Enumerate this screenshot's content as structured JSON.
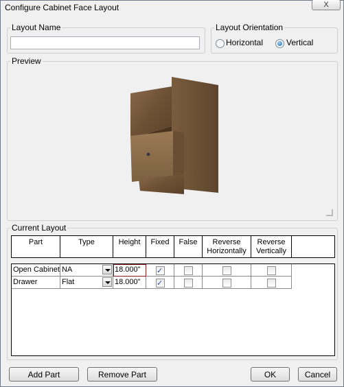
{
  "window": {
    "title": "Configure Cabinet Face Layout",
    "close_label": "X"
  },
  "layout_name": {
    "label": "Layout Name",
    "value": ""
  },
  "orientation": {
    "label": "Layout Orientation",
    "options": [
      {
        "label": "Horizontal",
        "selected": false
      },
      {
        "label": "Vertical",
        "selected": true
      }
    ]
  },
  "preview": {
    "label": "Preview"
  },
  "current_layout": {
    "label": "Current Layout",
    "columns": [
      "Part",
      "Type",
      "Height",
      "Fixed",
      "False",
      "Reverse Horizontally",
      "Reverse Vertically"
    ],
    "rows": [
      {
        "part": "Open Cabinet",
        "type": "NA",
        "height": "18.000\"",
        "fixed": true,
        "false": false,
        "rev_h": false,
        "rev_v": false
      },
      {
        "part": "Drawer",
        "type": "Flat",
        "height": "18.000\"",
        "fixed": true,
        "false": false,
        "rev_h": false,
        "rev_v": false
      }
    ]
  },
  "buttons": {
    "add_part": "Add Part",
    "remove_part": "Remove Part",
    "ok": "OK",
    "cancel": "Cancel"
  }
}
